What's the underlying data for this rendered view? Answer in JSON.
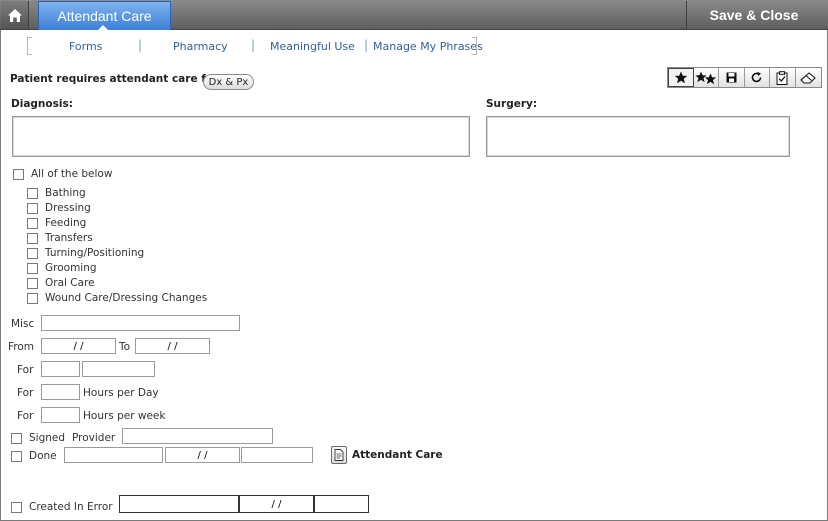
{
  "header": {
    "home_icon": "home-icon",
    "active_tab": "Attendant Care",
    "save_close": "Save & Close"
  },
  "subnav": {
    "items": [
      "Forms",
      "Pharmacy",
      "Meaningful Use",
      "Manage My Phrases"
    ]
  },
  "patient": {
    "requires_label": "Patient requires attendant care for",
    "dx_px_button": "Dx & Px"
  },
  "toolbar": {
    "icons": [
      "star-icon",
      "double-star-icon",
      "save-disk-icon",
      "refresh-icon",
      "clipboard-check-icon",
      "eraser-icon"
    ]
  },
  "diagnosis": {
    "label": "Diagnosis:",
    "value": ""
  },
  "surgery": {
    "label": "Surgery:",
    "value": ""
  },
  "all_of_below": "All of the below",
  "care_items": [
    "Bathing",
    "Dressing",
    "Feeding",
    "Transfers",
    "Turning/Positioning",
    "Grooming",
    "Oral Care",
    "Wound Care/Dressing Changes"
  ],
  "misc": {
    "label": "Misc",
    "value": ""
  },
  "from": {
    "label": "From",
    "value": "/ /"
  },
  "to": {
    "label": "To",
    "value": "/ /"
  },
  "for_duration": {
    "label": "For",
    "value": "",
    "unit": ""
  },
  "hours_day": {
    "label": "For",
    "value": "",
    "suffix": "Hours per Day"
  },
  "hours_week": {
    "label": "For",
    "value": "",
    "suffix": "Hours per week"
  },
  "signed": {
    "label": "Signed",
    "provider_label": "Provider",
    "provider_value": ""
  },
  "done": {
    "label": "Done",
    "field1": "",
    "date": "/ /",
    "field3": "",
    "link_label": "Attendant Care"
  },
  "created_in_error": {
    "label": "Created In Error",
    "field1": "",
    "date": "/ /",
    "field3": ""
  }
}
